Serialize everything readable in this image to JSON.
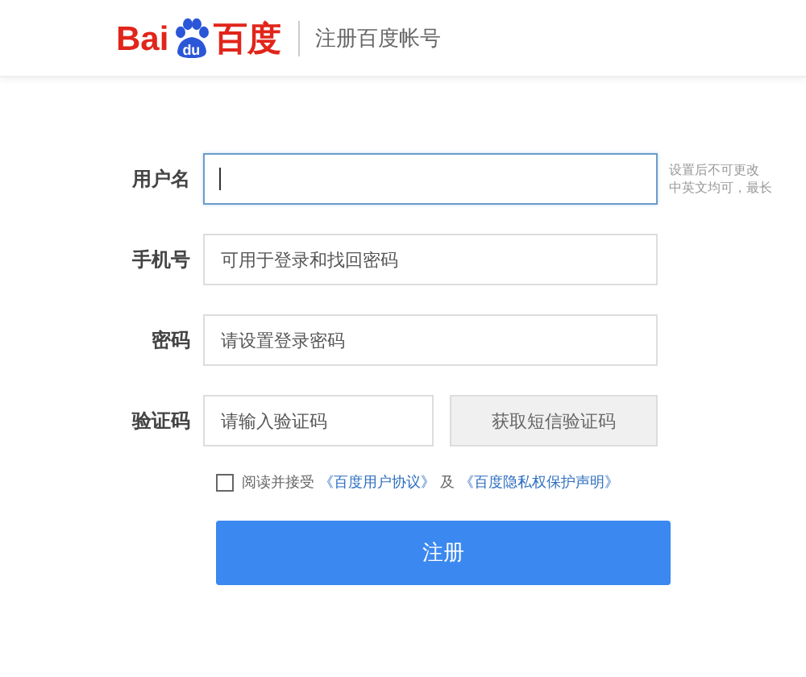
{
  "header": {
    "logo": {
      "left": "Bai",
      "paw": "du",
      "right": "百度"
    },
    "title": "注册百度帐号"
  },
  "fields": [
    {
      "kind": "input",
      "label": "用户名",
      "focused": true,
      "hint": [
        "设置后不可更改",
        "中英文均可，最长"
      ]
    },
    {
      "kind": "input",
      "label": "手机号",
      "placeholder": "可用于登录和找回密码",
      "focused": false
    },
    {
      "kind": "input",
      "label": "密码",
      "placeholder": "请设置登录密码",
      "focused": false
    },
    {
      "kind": "code",
      "label": "验证码",
      "placeholder": "请输入验证码",
      "focused": false,
      "button": "获取短信验证码"
    }
  ],
  "agreement": {
    "checked": false,
    "text": "阅读并接受",
    "links": [
      "《百度用户协议》",
      "《百度隐私权保护声明》"
    ],
    "joiner": "及"
  },
  "submit": "注册"
}
